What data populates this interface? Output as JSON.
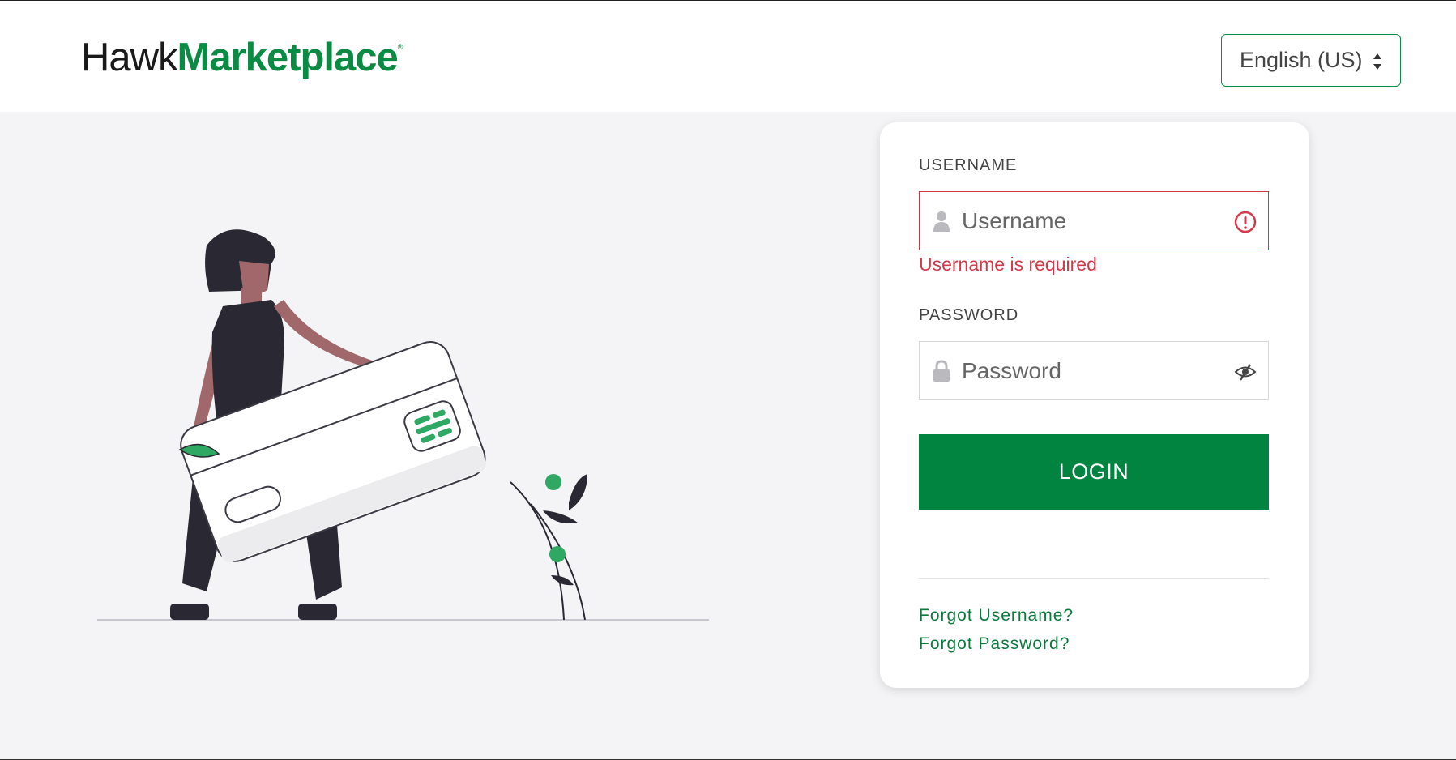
{
  "header": {
    "logo": {
      "part1": "Hawk",
      "part2": "Marketplace",
      "reg": "®"
    },
    "language": {
      "selected": "English (US)"
    }
  },
  "login_form": {
    "username": {
      "label": "USERNAME",
      "placeholder": "Username",
      "value": "",
      "error": "Username is required"
    },
    "password": {
      "label": "PASSWORD",
      "placeholder": "Password",
      "value": ""
    },
    "login_button": "LOGIN",
    "forgot_username": "Forgot Username?",
    "forgot_password": "Forgot Password?"
  },
  "icons": {
    "username": "user-icon",
    "error": "error-circle-icon",
    "password": "lock-icon",
    "toggle_password": "eye-slash-icon",
    "language": "sort-arrows-icon"
  },
  "colors": {
    "brand_green": "#00843f",
    "error_red": "#d23a4a",
    "page_bg": "#f4f4f6"
  }
}
